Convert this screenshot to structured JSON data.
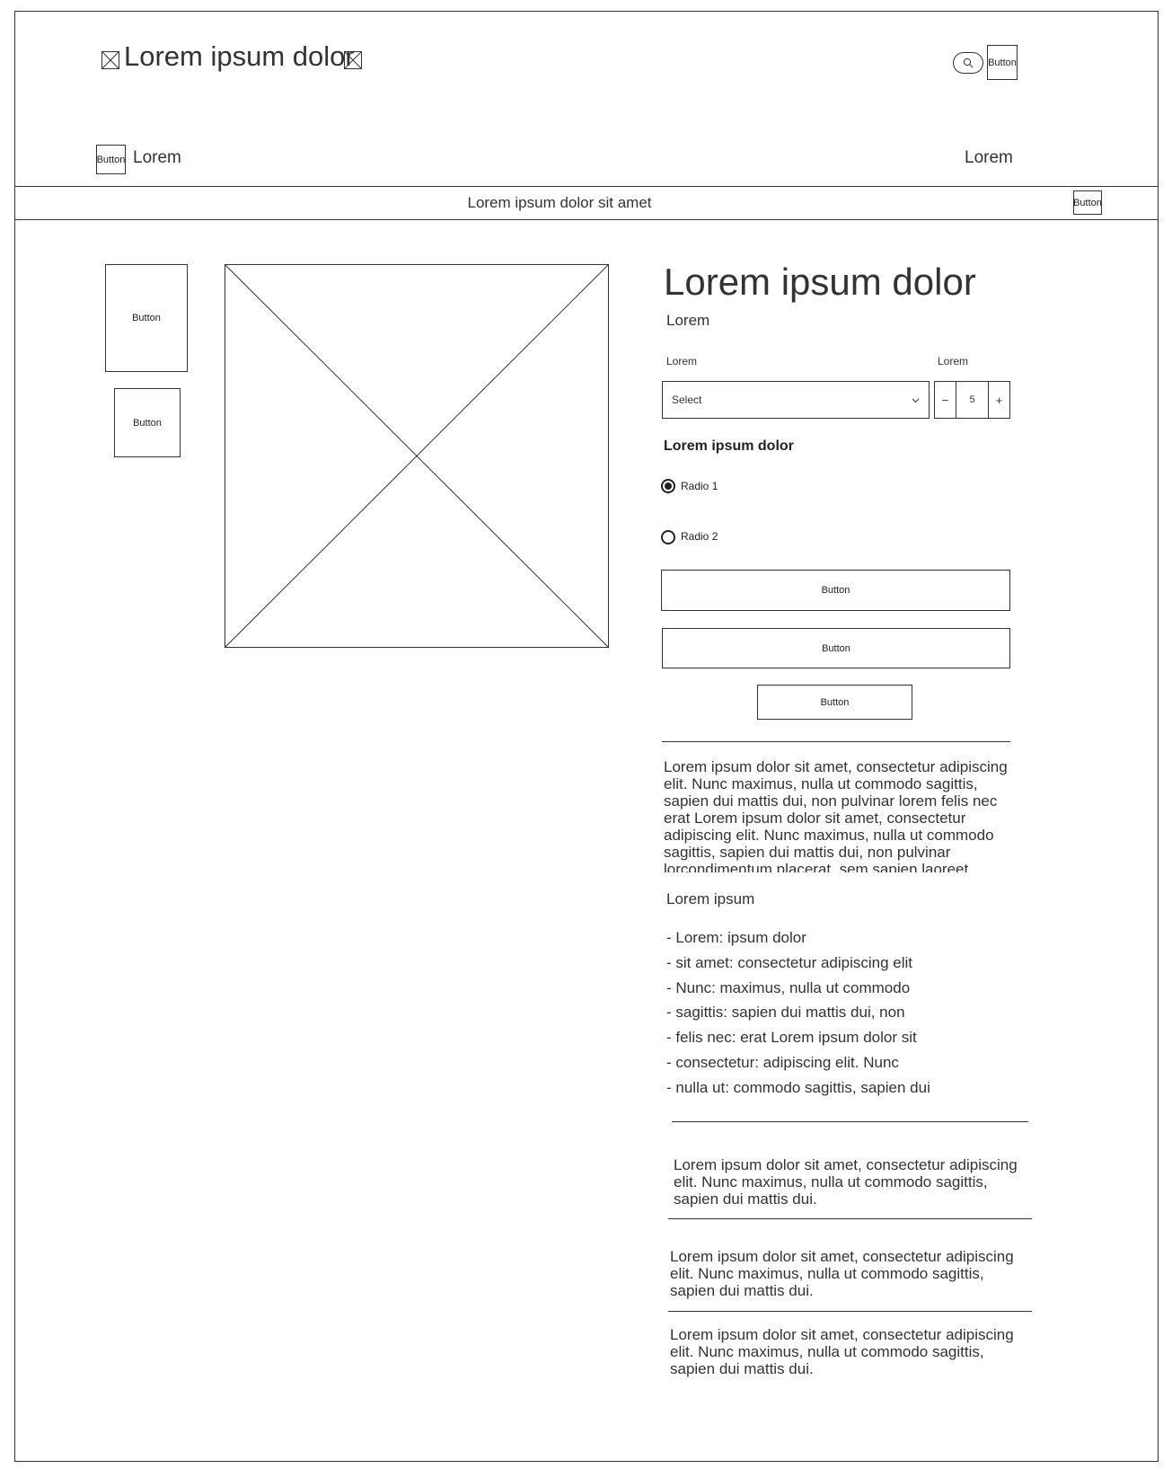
{
  "header": {
    "logo_text": "Lorem ipsum dolor",
    "logo_left_icon": "broken-image-icon",
    "logo_right_icon": "broken-image-icon",
    "search_icon": "search-icon",
    "header_button_label": "Button"
  },
  "nav": {
    "left_button_label": "Button",
    "left_text": "Lorem",
    "right_text": "Lorem"
  },
  "banner": {
    "text": "Lorem ipsum dolor sit amet",
    "button_label": "Button"
  },
  "gallery": {
    "thumb_1_label": "Button",
    "thumb_2_label": "Button",
    "main_image": "image-placeholder"
  },
  "product": {
    "title": "Lorem ipsum dolor",
    "subtitle": "Lorem",
    "variant_label": "Lorem",
    "quantity_label": "Lorem",
    "select_value": "Select",
    "quantity_minus": "−",
    "quantity_value": "5",
    "quantity_plus": "+",
    "options_title": "Lorem ipsum dolor",
    "radio_1_label": "Radio 1",
    "radio_2_label": "Radio 2",
    "radio_selected": "Radio 1",
    "button_1_label": "Button",
    "button_2_label": "Button",
    "button_3_label": "Button",
    "description": "Lorem ipsum dolor sit amet, consectetur adipiscing elit. Nunc maximus, nulla ut commodo sagittis, sapien dui mattis dui, non pulvinar lorem felis nec erat Lorem ipsum dolor sit amet, consectetur adipiscing elit. Nunc maximus, nulla ut commodo sagittis, sapien dui mattis dui, non pulvinar lorcondimentum placerat, sem sapien laoreet",
    "specs_title": "Lorem ipsum",
    "specs": [
      "- Lorem: ipsum dolor",
      "- sit amet: consectetur adipiscing elit",
      "- Nunc: maximus, nulla ut commodo",
      "- sagittis: sapien dui mattis dui, non",
      "- felis nec: erat Lorem ipsum dolor sit",
      "- consectetur: adipiscing elit. Nunc",
      "- nulla ut: commodo sagittis, sapien dui"
    ],
    "accordion": [
      "Lorem ipsum dolor sit amet, consectetur adipiscing elit. Nunc maximus, nulla ut commodo sagittis, sapien dui mattis dui.",
      "Lorem ipsum dolor sit amet, consectetur adipiscing elit. Nunc maximus, nulla ut commodo sagittis, sapien dui mattis dui.",
      "Lorem ipsum dolor sit amet, consectetur adipiscing elit. Nunc maximus, nulla ut commodo sagittis, sapien dui mattis dui."
    ]
  }
}
